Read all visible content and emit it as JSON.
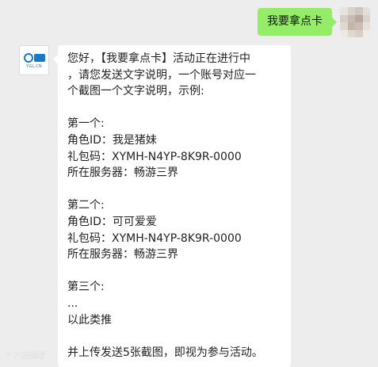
{
  "colors": {
    "background": "#ededed",
    "outgoing_bubble": "#95ec69",
    "incoming_bubble": "#ffffff",
    "brand_blue": "#1a78c8"
  },
  "outgoing": {
    "text": "我要拿点卡"
  },
  "user_avatar": {
    "icon": "user-avatar-blurred",
    "pixels": [
      "#e8e3dd",
      "#d9d2cb",
      "#cfc6bd",
      "#e4ded8",
      "#d6cdc4",
      "#c9bbb0",
      "#b9a89b",
      "#dbd4ce",
      "#e0d8d1",
      "#c6b6aa",
      "#cbbdb3",
      "#e6e0da",
      "#ece8e4",
      "#dfd8d1",
      "#d8cfc6",
      "#eeeae6"
    ]
  },
  "official_avatar": {
    "icon": "official-account-logo",
    "caption": "YGL.CN"
  },
  "incoming": {
    "lines": [
      "您好，【我要拿点卡】活动正在进行中",
      "，请您发送文字说明，一个账号对应一",
      "个截图一个文字说明，示例:",
      "",
      "第一个:",
      "角色ID：我是猪妹",
      "礼包码：XYMH-N4YP-8K9R-0000",
      "所在服务器：畅游三界",
      "",
      "第二个:",
      "角色ID：可可爱爱",
      "礼包码：XYMH-N4YP-8K9R-0000",
      "所在服务器：畅游三界",
      "",
      "第三个:",
      "...",
      "以此类推",
      "",
      "并上传发送5张截图，即视为参与活动。"
    ]
  },
  "watermark": {
    "text": "六道题看"
  }
}
